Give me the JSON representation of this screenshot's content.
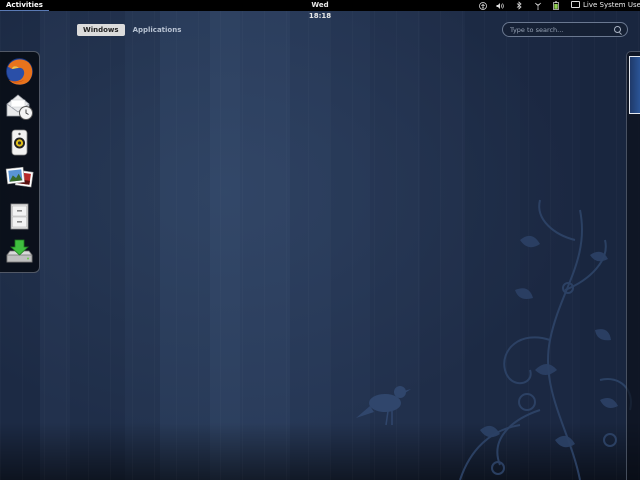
{
  "top_panel": {
    "activities_label": "Activities",
    "clock": "Wed 18:18",
    "tray_icons": [
      "accessibility-icon",
      "volume-icon",
      "bluetooth-icon",
      "network-icon",
      "battery-icon"
    ],
    "user_name": "Live System User"
  },
  "overview": {
    "tabs": [
      {
        "label": "Windows",
        "active": true
      },
      {
        "label": "Applications",
        "active": false
      }
    ],
    "search": {
      "placeholder": "Type to search..."
    }
  },
  "dash": {
    "items": [
      {
        "name": "firefox",
        "icon": "firefox-icon"
      },
      {
        "name": "evolution",
        "icon": "mail-clock-icon"
      },
      {
        "name": "rhythmbox",
        "icon": "speaker-icon"
      },
      {
        "name": "shotwell",
        "icon": "photos-icon"
      },
      {
        "name": "files",
        "icon": "file-cabinet-icon"
      },
      {
        "name": "install-to-hard-drive",
        "icon": "install-icon"
      }
    ]
  },
  "colors": {
    "panel": "#000000",
    "wallpaper": "#1f2d48",
    "accent": "#5a7ab5"
  }
}
